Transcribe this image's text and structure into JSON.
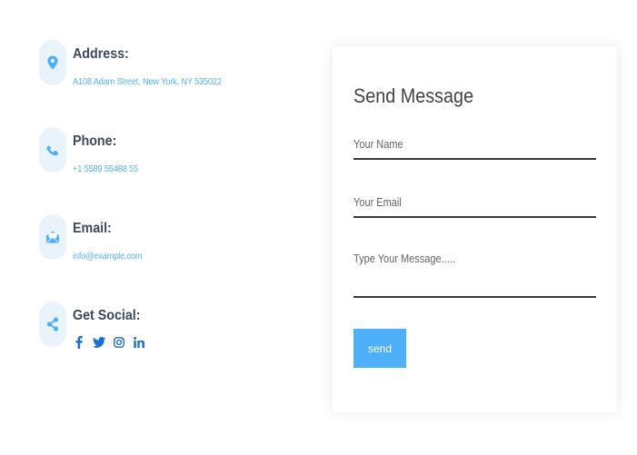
{
  "contact_info": {
    "address": {
      "title": "Address:",
      "text": "A108 Adam Street, New York, NY 535022",
      "icon": "map-pin-icon"
    },
    "phone": {
      "title": "Phone:",
      "text": "+1 5589 55488 55",
      "icon": "phone-icon"
    },
    "email": {
      "title": "Email:",
      "text": "info@example.com",
      "icon": "envelope-open-icon"
    },
    "social": {
      "title": "Get Social:",
      "icon": "share-icon",
      "links": [
        "facebook",
        "twitter",
        "instagram",
        "linkedin"
      ]
    }
  },
  "form": {
    "title": "Send Message",
    "name_placeholder": "Your Name",
    "email_placeholder": "Your Email",
    "message_placeholder": "Type Your Message.....",
    "send_label": "send"
  },
  "colors": {
    "accent": "#4db0f8",
    "icon_bg": "#e9f3fb",
    "heading": "#3c4a5c",
    "social": "#1d6fd1"
  }
}
